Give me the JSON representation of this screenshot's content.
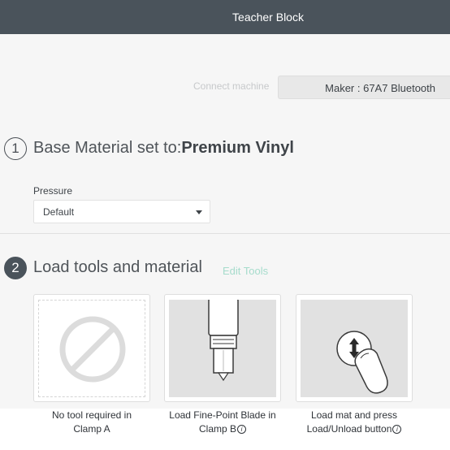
{
  "header": {
    "title": "Teacher Block"
  },
  "machine": {
    "connect_label": "Connect machine",
    "selected_machine": "Maker : 67A7 Bluetooth"
  },
  "step1": {
    "number": "1",
    "title_prefix": "Base Material set to:",
    "material": "Premium Vinyl",
    "pressure_label": "Pressure",
    "pressure_value": "Default"
  },
  "step2": {
    "number": "2",
    "title": "Load tools and material",
    "edit_tools_label": "Edit Tools",
    "cards": [
      {
        "icon": "no-tool-icon",
        "line1": "No tool required in",
        "line2": "Clamp A"
      },
      {
        "icon": "fine-point-blade-icon",
        "line1": "Load Fine-Point Blade in",
        "line2": "Clamp B"
      },
      {
        "icon": "load-unload-button-icon",
        "line1": "Load mat and press",
        "line2": "Load/Unload button"
      }
    ],
    "info_glyph": "i"
  },
  "colors": {
    "header_bg": "#4a535b",
    "accent_link": "#a6dccc",
    "panel_bg": "#f6f6f6"
  }
}
